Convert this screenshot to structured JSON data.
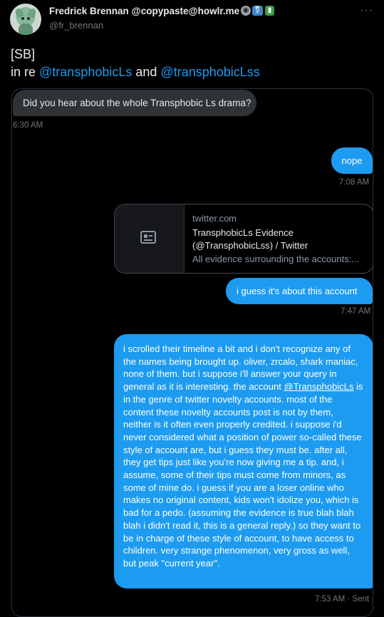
{
  "author": {
    "display_name": "Fredrick Brennan @copypaste@howlr.me",
    "handle": "@fr_brennan",
    "name_emojis": [
      "raccoon",
      "transgender-flag",
      "green-book"
    ]
  },
  "more_label": "···",
  "tweet": {
    "line1": "[SB]",
    "line2_prefix": "in re ",
    "mention1": "@transphobicLs",
    "line2_mid": " and ",
    "mention2": "@transphobicLss"
  },
  "screenshot": {
    "msg1": "Did you hear about the whole Transphobic Ls drama?",
    "time1": "6:30 AM",
    "msg2": "nope",
    "time2": "7:08 AM",
    "link_card": {
      "domain": "twitter.com",
      "title_line1": "TransphobicLs Evidence",
      "title_line2": "(@TransphobicLss) / Twitter",
      "description": "All evidence surrounding the accounts:..."
    },
    "msg3": "i guess it's about this account",
    "time3": "7:47 AM",
    "msg4_part1": "i scrolled their timeline a bit and i don't recognize any of the names being brought up. oliver, zrcalo, shark maniac, none of them. but i suppose i'll answer your query in general as it is interesting. the account ",
    "msg4_mention": "@TransphobicLs",
    "msg4_part2": " is in the genre of twitter novelty accounts. most of the content these novelty accounts post is not by them, neither is it often even properly credited. i suppose i'd never considered what a position of power so-called these style of account are, but i guess they must be. after all, they get tips just like you're now giving me a tip. and, i assume, some of their tips must come from minors, as some of mine do. i guess if you are a loser online who makes no original content, kids won't idolize you, which is bad for a pedo. (assuming the evidence is true blah blah blah i didn't read it, this is a general reply.) so they want to be in charge of these style of account, to have access to children. very strange phenomenon, very gross as well, but peak \"current year\".",
    "time4": "7:53 AM · Sent"
  },
  "colors": {
    "background": "#000000",
    "accent": "#1d9bf0",
    "incoming_bubble": "#2f3336",
    "muted_text": "#71767b"
  }
}
